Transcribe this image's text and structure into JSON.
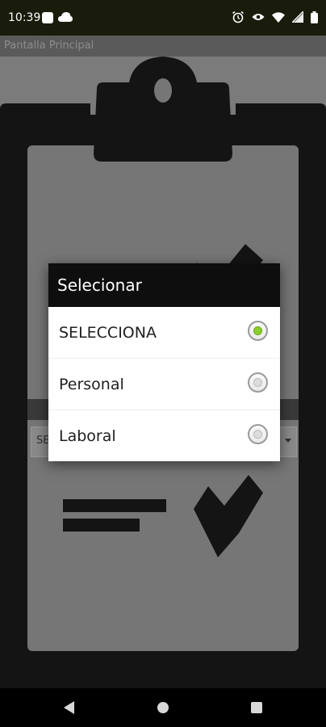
{
  "status_bar": {
    "time": "10:39",
    "icons": [
      "square-icon",
      "cloud-icon",
      "alarm-icon",
      "eye-icon",
      "wifi-icon",
      "signal-icon",
      "battery-icon"
    ]
  },
  "app_bar": {
    "title": "Pantalla Principal"
  },
  "background": {
    "spinner_text": "SE"
  },
  "dialog": {
    "title": "Selecionar",
    "options": [
      {
        "label": "SELECCIONA",
        "selected": true
      },
      {
        "label": "Personal",
        "selected": false
      },
      {
        "label": "Laboral",
        "selected": false
      }
    ]
  },
  "colors": {
    "status_bar": "#191b0b",
    "dialog_title_bg": "#0e0e0e",
    "radio_selected": "#8bcd2b",
    "clipboard": "#141414"
  },
  "nav_bar": {
    "icons": [
      "back-icon",
      "home-icon",
      "recents-icon"
    ]
  }
}
